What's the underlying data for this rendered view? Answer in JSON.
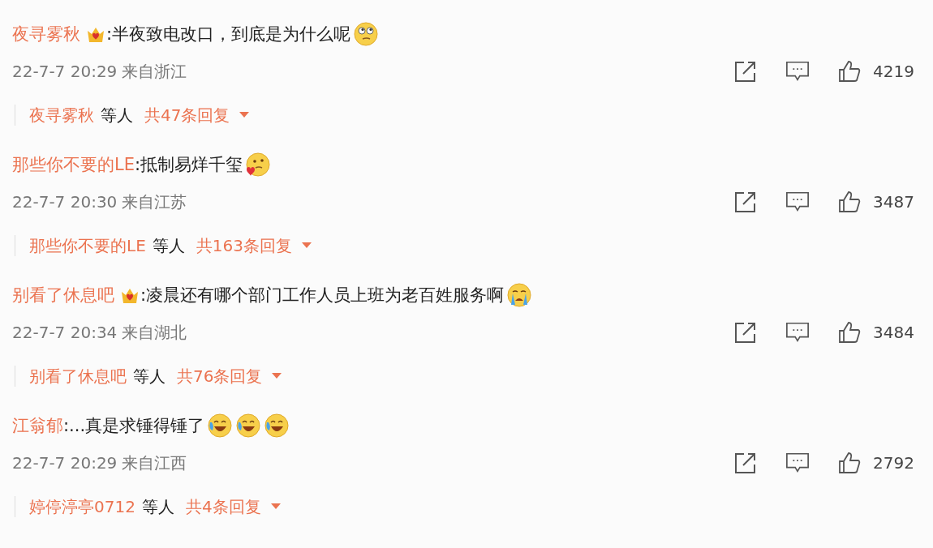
{
  "comments": [
    {
      "user": "夜寻雾秋",
      "badge": true,
      "text": ":半夜致电改口，到底是为什么呢",
      "emojis": [
        {
          "kind": "rolling-eyes"
        }
      ],
      "time": "22-7-7 20:29",
      "location": "来自浙江",
      "likes": "4219",
      "reply_preview": {
        "user": "夜寻雾秋",
        "suffix": "等人",
        "count": "共47条回复"
      }
    },
    {
      "user": "那些你不要的LE",
      "badge": false,
      "text": ":抵制易烊千玺",
      "emojis": [
        {
          "kind": "heart-thinking"
        }
      ],
      "time": "22-7-7 20:30",
      "location": "来自江苏",
      "likes": "3487",
      "reply_preview": {
        "user": "那些你不要的LE",
        "suffix": "等人",
        "count": "共163条回复"
      }
    },
    {
      "user": "别看了休息吧",
      "badge": true,
      "text": ":凌晨还有哪个部门工作人员上班为老百姓服务啊",
      "emojis": [
        {
          "kind": "crying"
        }
      ],
      "time": "22-7-7 20:34",
      "location": "来自湖北",
      "likes": "3484",
      "reply_preview": {
        "user": "别看了休息吧",
        "suffix": "等人",
        "count": "共76条回复"
      }
    },
    {
      "user": "江翁郁",
      "badge": false,
      "text": ":...真是求锤得锤了",
      "emojis": [
        {
          "kind": "laughing-crying"
        },
        {
          "kind": "laughing-crying"
        },
        {
          "kind": "laughing-crying"
        }
      ],
      "time": "22-7-7 20:29",
      "location": "来自江西",
      "likes": "2792",
      "reply_preview": {
        "user": "婷停渟亭0712",
        "suffix": "等人",
        "count": "共4条回复"
      }
    }
  ]
}
